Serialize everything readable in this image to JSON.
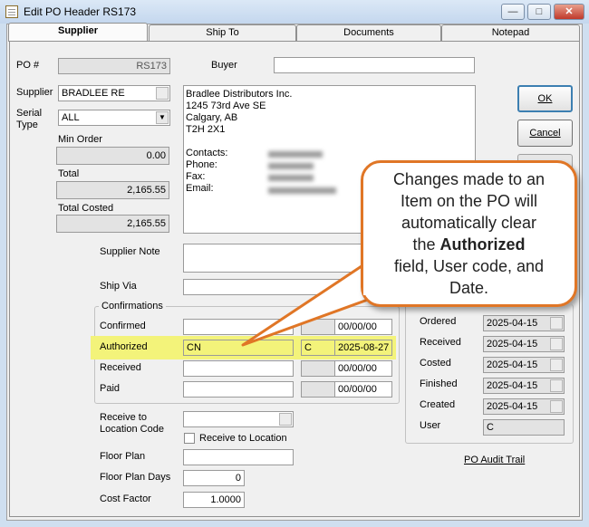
{
  "window": {
    "title": "Edit PO Header RS173",
    "minimize": "—",
    "maximize": "□",
    "close": "✕"
  },
  "tabs": [
    "Supplier",
    "Ship To",
    "Documents",
    "Notepad"
  ],
  "form": {
    "po_label": "PO #",
    "po_value": "RS173",
    "buyer_label": "Buyer",
    "buyer_value": "",
    "supplier_label": "Supplier",
    "supplier_value": "BRADLEE RE",
    "serial_label_1": "Serial",
    "serial_label_2": "Type",
    "serial_value": "ALL",
    "min_order_label": "Min Order",
    "min_order_value": "0.00",
    "total_label": "Total",
    "total_value": "2,165.55",
    "total_costed_label": "Total Costed",
    "total_costed_value": "2,165.55",
    "supplier_note_label": "Supplier Note",
    "ship_via_label": "Ship Via",
    "receive_to_label_1": "Receive to",
    "receive_to_label_2": "Location Code",
    "receive_to_location_label": "Receive to Location",
    "floor_plan_label": "Floor Plan",
    "floor_plan_days_label": "Floor Plan Days",
    "floor_plan_days_value": "0",
    "cost_factor_label": "Cost Factor",
    "cost_factor_value": "1.0000"
  },
  "supplier_info": {
    "lines": [
      "Bradlee Distributors Inc.",
      "1245 73rd Ave SE",
      "Calgary, AB",
      "T2H 2X1"
    ],
    "contact_labels": [
      "Contacts:",
      "Phone:",
      "Fax:",
      "Email:"
    ]
  },
  "buttons": {
    "ok": "OK",
    "cancel": "Cancel"
  },
  "confirmations": {
    "title": "Confirmations",
    "rows": [
      {
        "label": "Confirmed",
        "user": "",
        "code": "",
        "date": "00/00/00"
      },
      {
        "label": "Authorized",
        "user": "CN",
        "code": "C",
        "date": "2025-08-27"
      },
      {
        "label": "Received",
        "user": "",
        "code": "",
        "date": "00/00/00"
      },
      {
        "label": "Paid",
        "user": "",
        "code": "",
        "date": "00/00/00"
      }
    ]
  },
  "status": {
    "rows": [
      {
        "label": "Ordered",
        "value": "2025-04-15"
      },
      {
        "label": "Received",
        "value": "2025-04-15"
      },
      {
        "label": "Costed",
        "value": "2025-04-15"
      },
      {
        "label": "Finished",
        "value": "2025-04-15"
      },
      {
        "label": "Created",
        "value": "2025-04-15"
      },
      {
        "label": "User",
        "value": "C"
      }
    ],
    "audit_link": "PO Audit Trail"
  },
  "callout": {
    "line1": "Changes made to an",
    "line2": "Item on the PO will",
    "line3": "automatically clear",
    "line4_pre": "the ",
    "line4_bold": "Authorized",
    "line5": "field, User code, and",
    "line6": "Date."
  },
  "colors": {
    "callout_border": "#e07626",
    "highlight": "#f3f37a",
    "title_bar": "#c4d7ee"
  }
}
